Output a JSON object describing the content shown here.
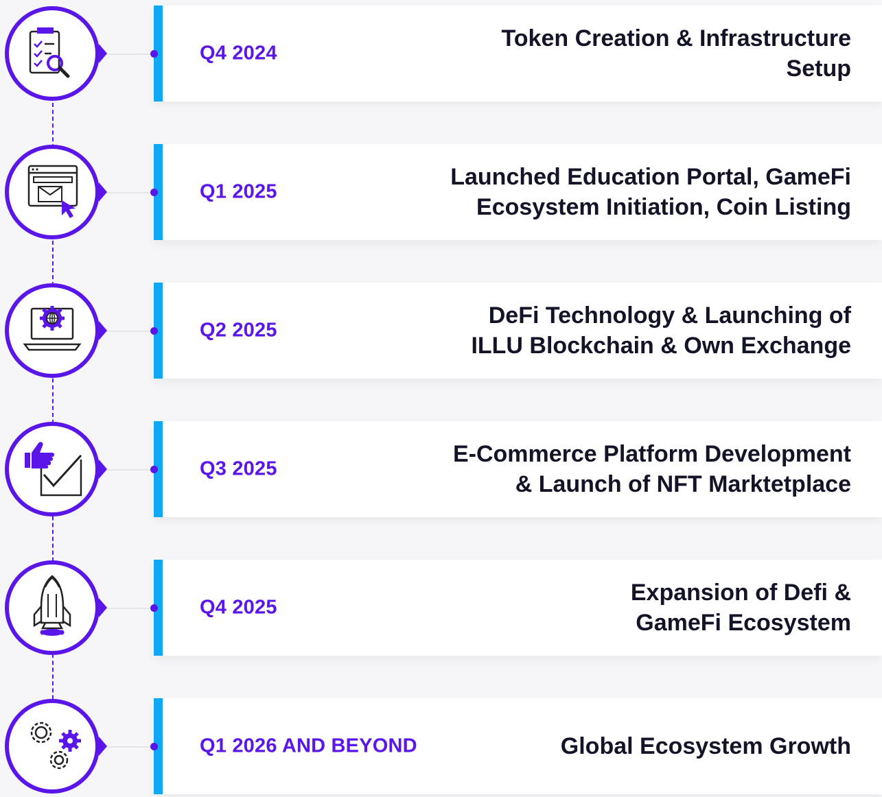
{
  "colors": {
    "accent": "#5a16e8",
    "bar": "#0ea8f5",
    "text": "#141428",
    "background": "#f6f6f8",
    "card": "#ffffff"
  },
  "milestones": [
    {
      "quarter": "Q4 2024",
      "title_line1": "Token Creation & Infrastructure",
      "title_line2": "Setup",
      "icon": "checklist-search-icon"
    },
    {
      "quarter": "Q1 2025",
      "title_line1": "Launched Education Portal, GameFi",
      "title_line2": "Ecosystem Initiation, Coin Listing",
      "icon": "web-mail-cursor-icon"
    },
    {
      "quarter": "Q2 2025",
      "title_line1": "DeFi Technology & Launching of",
      "title_line2": "ILLU Blockchain & Own Exchange",
      "icon": "laptop-gear-globe-icon"
    },
    {
      "quarter": "Q3 2025",
      "title_line1": "E-Commerce Platform Development",
      "title_line2": "& Launch of NFT Marktetplace",
      "icon": "thumbs-up-checkbox-icon"
    },
    {
      "quarter": "Q4 2025",
      "title_line1": "Expansion of Defi &",
      "title_line2": "GameFi Ecosystem",
      "icon": "rocket-icon"
    },
    {
      "quarter": "Q1 2026 AND BEYOND",
      "title_line1": "Global Ecosystem Growth",
      "title_line2": "",
      "icon": "gears-icon"
    }
  ]
}
